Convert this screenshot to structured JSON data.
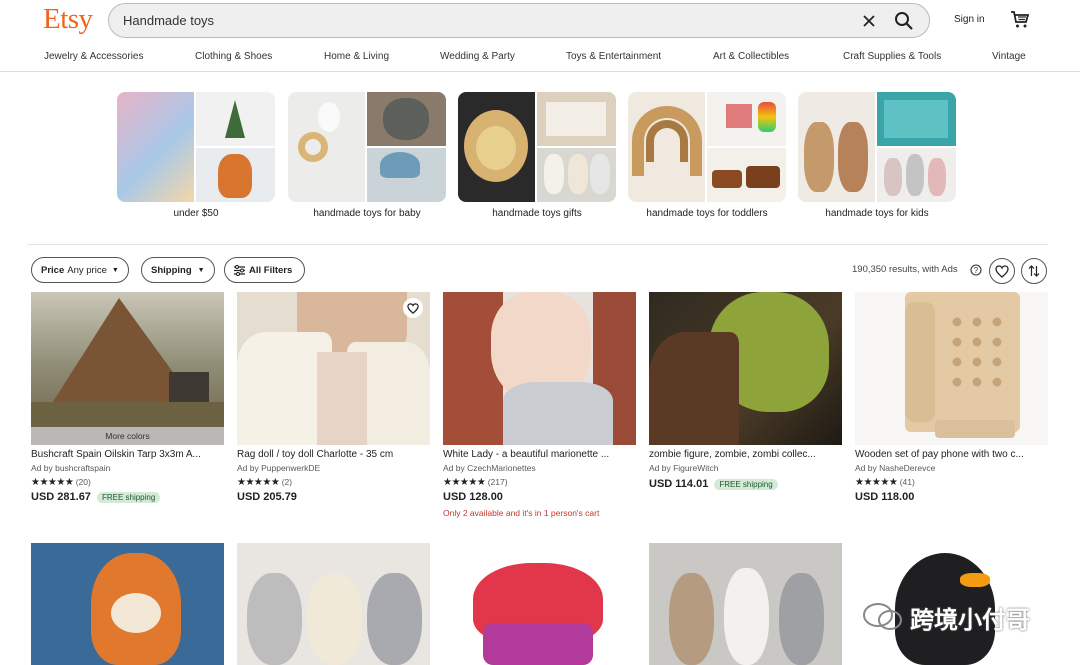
{
  "header": {
    "logo": "Etsy",
    "search_value": "Handmade toys",
    "signin": "Sign in",
    "icons": [
      "close-icon",
      "search-icon",
      "cart-icon"
    ],
    "brand_color": "#F1641E"
  },
  "nav": [
    "Jewelry & Accessories",
    "Clothing & Shoes",
    "Home & Living",
    "Wedding & Party",
    "Toys & Entertainment",
    "Art & Collectibles",
    "Craft Supplies & Tools",
    "Vintage"
  ],
  "categories": [
    "under $50",
    "handmade toys for baby",
    "handmade toys gifts",
    "handmade toys for toddlers",
    "handmade toys for kids"
  ],
  "filters": {
    "price_label": "Price",
    "price_value": "Any price",
    "shipping": "Shipping",
    "all_filters": "All Filters",
    "results": "190,350 results, with Ads"
  },
  "products": [
    {
      "title": "Bushcraft Spain Oilskin Tarp 3x3m A...",
      "ad": "Ad by bushcraftspain",
      "stars": "★★★★★",
      "reviews": "(20)",
      "price": "USD 281.67",
      "badge": "FREE shipping",
      "overlay": "More colors"
    },
    {
      "title": "Rag doll / toy doll Charlotte - 35 cm",
      "ad": "Ad by PuppenwerkDE",
      "stars": "★★★★★",
      "reviews": "(2)",
      "price": "USD 205.79"
    },
    {
      "title": "White Lady - a beautiful marionette ...",
      "ad": "Ad by CzechMarionettes",
      "stars": "★★★★★",
      "reviews": "(217)",
      "price": "USD 128.00",
      "stock": "Only 2 available and it's in 1 person's cart"
    },
    {
      "title": "zombie figure, zombie, zombi collec...",
      "ad": "Ad by FigureWitch",
      "price": "USD 114.01",
      "badge": "FREE shipping"
    },
    {
      "title": "Wooden set of pay phone with two c...",
      "ad": "Ad by NasheDerevce",
      "stars": "★★★★★",
      "reviews": "(41)",
      "price": "USD 118.00"
    }
  ],
  "watermark": "跨境小付哥"
}
